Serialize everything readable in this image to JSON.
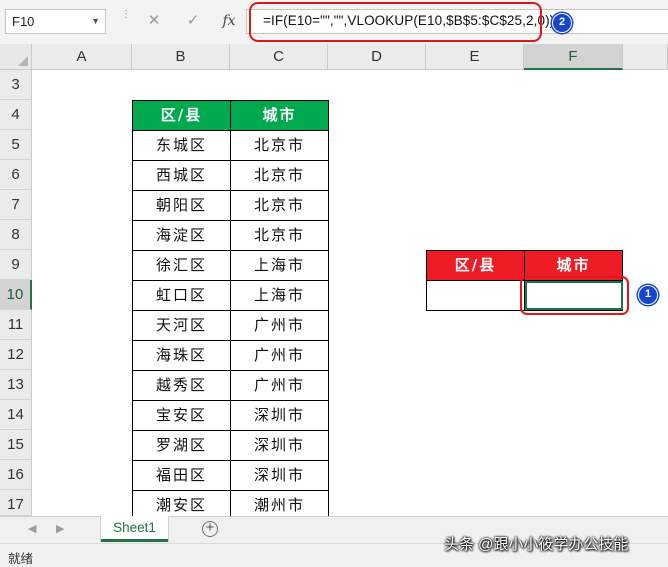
{
  "formula_bar": {
    "name_box": "F10",
    "cancel_icon": "✕",
    "enter_icon": "✓",
    "fx_label": "fx",
    "formula": "=IF(E10=\"\",\"\",VLOOKUP(E10,$B$5:$C$25,2,0))"
  },
  "annotations": {
    "badge_formula": "2",
    "badge_cell": "1"
  },
  "columns": [
    "A",
    "B",
    "C",
    "D",
    "E",
    "F"
  ],
  "rows": [
    "3",
    "4",
    "5",
    "6",
    "7",
    "8",
    "9",
    "10",
    "11",
    "12",
    "13",
    "14",
    "15",
    "16",
    "17"
  ],
  "selected": {
    "column": "F",
    "row": "10"
  },
  "lookup_table": {
    "headers": [
      "区/县",
      "城市"
    ],
    "rows": [
      [
        "东城区",
        "北京市"
      ],
      [
        "西城区",
        "北京市"
      ],
      [
        "朝阳区",
        "北京市"
      ],
      [
        "海淀区",
        "北京市"
      ],
      [
        "徐汇区",
        "上海市"
      ],
      [
        "虹口区",
        "上海市"
      ],
      [
        "天河区",
        "广州市"
      ],
      [
        "海珠区",
        "广州市"
      ],
      [
        "越秀区",
        "广州市"
      ],
      [
        "宝安区",
        "深圳市"
      ],
      [
        "罗湖区",
        "深圳市"
      ],
      [
        "福田区",
        "深圳市"
      ],
      [
        "潮安区",
        "潮州市"
      ]
    ]
  },
  "query_table": {
    "headers": [
      "区/县",
      "城市"
    ],
    "values": [
      "",
      ""
    ]
  },
  "sheet_tabs": {
    "active": "Sheet1",
    "add_icon": "+"
  },
  "status_bar": {
    "ready": "就绪"
  },
  "watermark": "头条 @跟小小筱学办公技能",
  "colors": {
    "green_header": "#00a84f",
    "red_header": "#ee1c24",
    "excel_green": "#217346",
    "annotation_red": "#e0161b",
    "badge_blue": "#1846c8"
  }
}
